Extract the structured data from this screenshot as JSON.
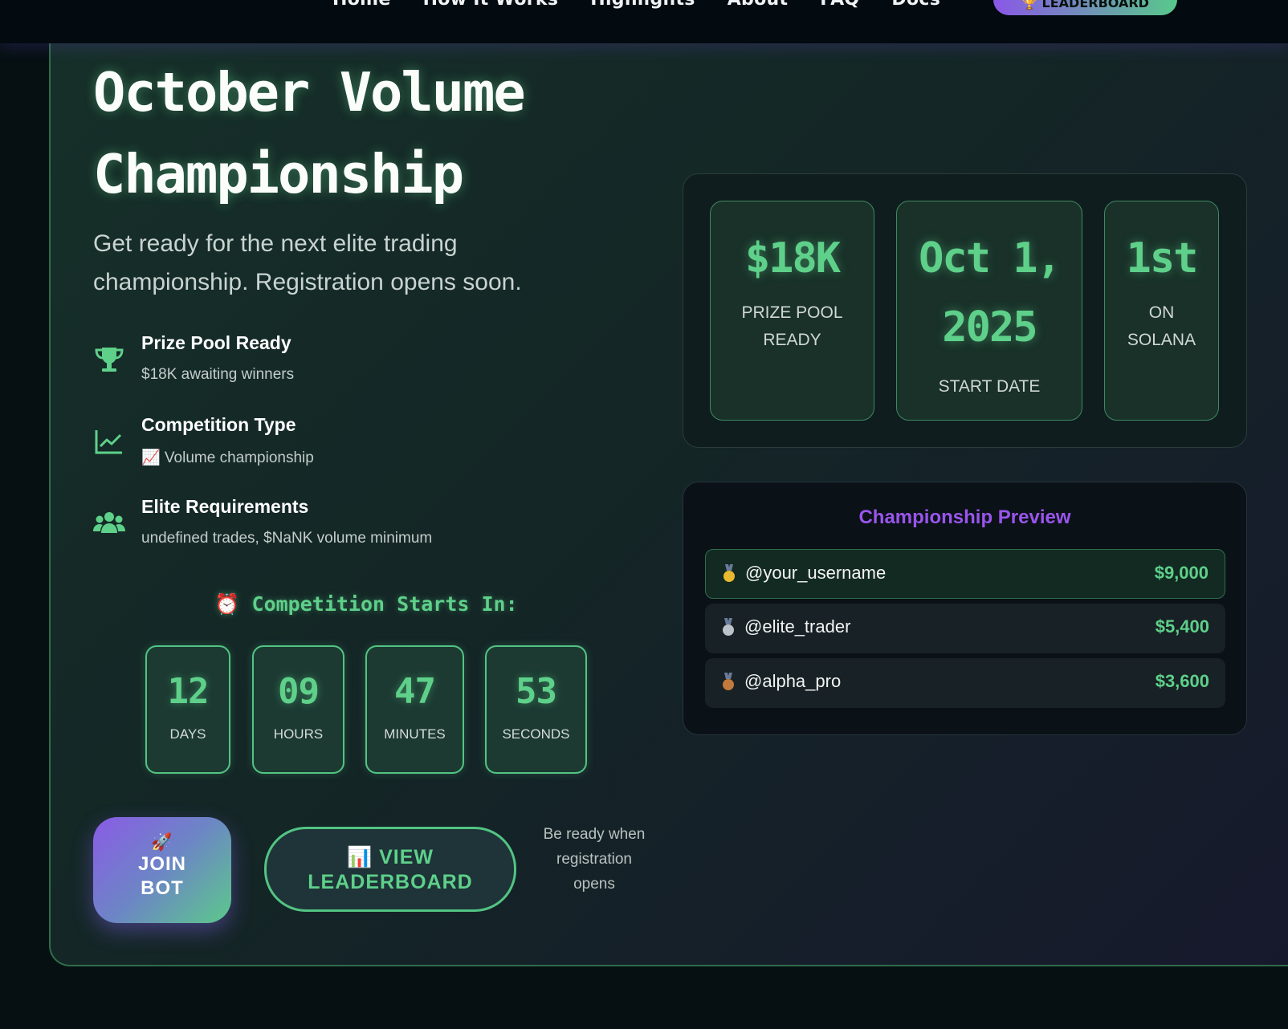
{
  "nav": {
    "links": [
      "Home",
      "How It Works",
      "Highlights",
      "About",
      "FAQ",
      "Docs"
    ],
    "cta_label": "🏆 LEADERBOARD"
  },
  "hero": {
    "title_line1": "October Volume",
    "title_line2": "Championship",
    "subtitle": "Get ready for the next elite trading championship. Registration opens soon.",
    "features": [
      {
        "icon": "trophy-icon",
        "title": "Prize Pool Ready",
        "desc": "$18K awaiting winners"
      },
      {
        "icon": "chart-line-icon",
        "title": "Competition Type",
        "desc": "📈 Volume championship"
      },
      {
        "icon": "users-icon",
        "title": "Elite Requirements",
        "desc": "undefined trades, $NaNK volume minimum"
      }
    ],
    "countdown_title": "⏰ Competition Starts In:",
    "countdown": [
      {
        "value": "12",
        "label": "DAYS"
      },
      {
        "value": "09",
        "label": "HOURS"
      },
      {
        "value": "47",
        "label": "MINUTES"
      },
      {
        "value": "53",
        "label": "SECONDS"
      }
    ],
    "join_icon": "🚀",
    "join_label": "JOIN BOT",
    "view_label": "📊 VIEW LEADERBOARD",
    "ready_note": "Be ready when registration opens"
  },
  "stats": [
    {
      "value": "$18K",
      "label": "PRIZE POOL READY"
    },
    {
      "value": "Oct 1, 2025",
      "label": "START DATE"
    },
    {
      "value": "1st",
      "label": "ON SOLANA"
    }
  ],
  "preview": {
    "title": "Championship Preview",
    "rows": [
      {
        "medal": "gold-medal-icon",
        "user": "@your_username",
        "amount": "$9,000"
      },
      {
        "medal": "silver-medal-icon",
        "user": "@elite_trader",
        "amount": "$5,400"
      },
      {
        "medal": "bronze-medal-icon",
        "user": "@alpha_pro",
        "amount": "$3,600"
      }
    ]
  },
  "colors": {
    "accent_green": "#5ed08a",
    "accent_purple": "#9a55ec",
    "background": "#061012"
  }
}
